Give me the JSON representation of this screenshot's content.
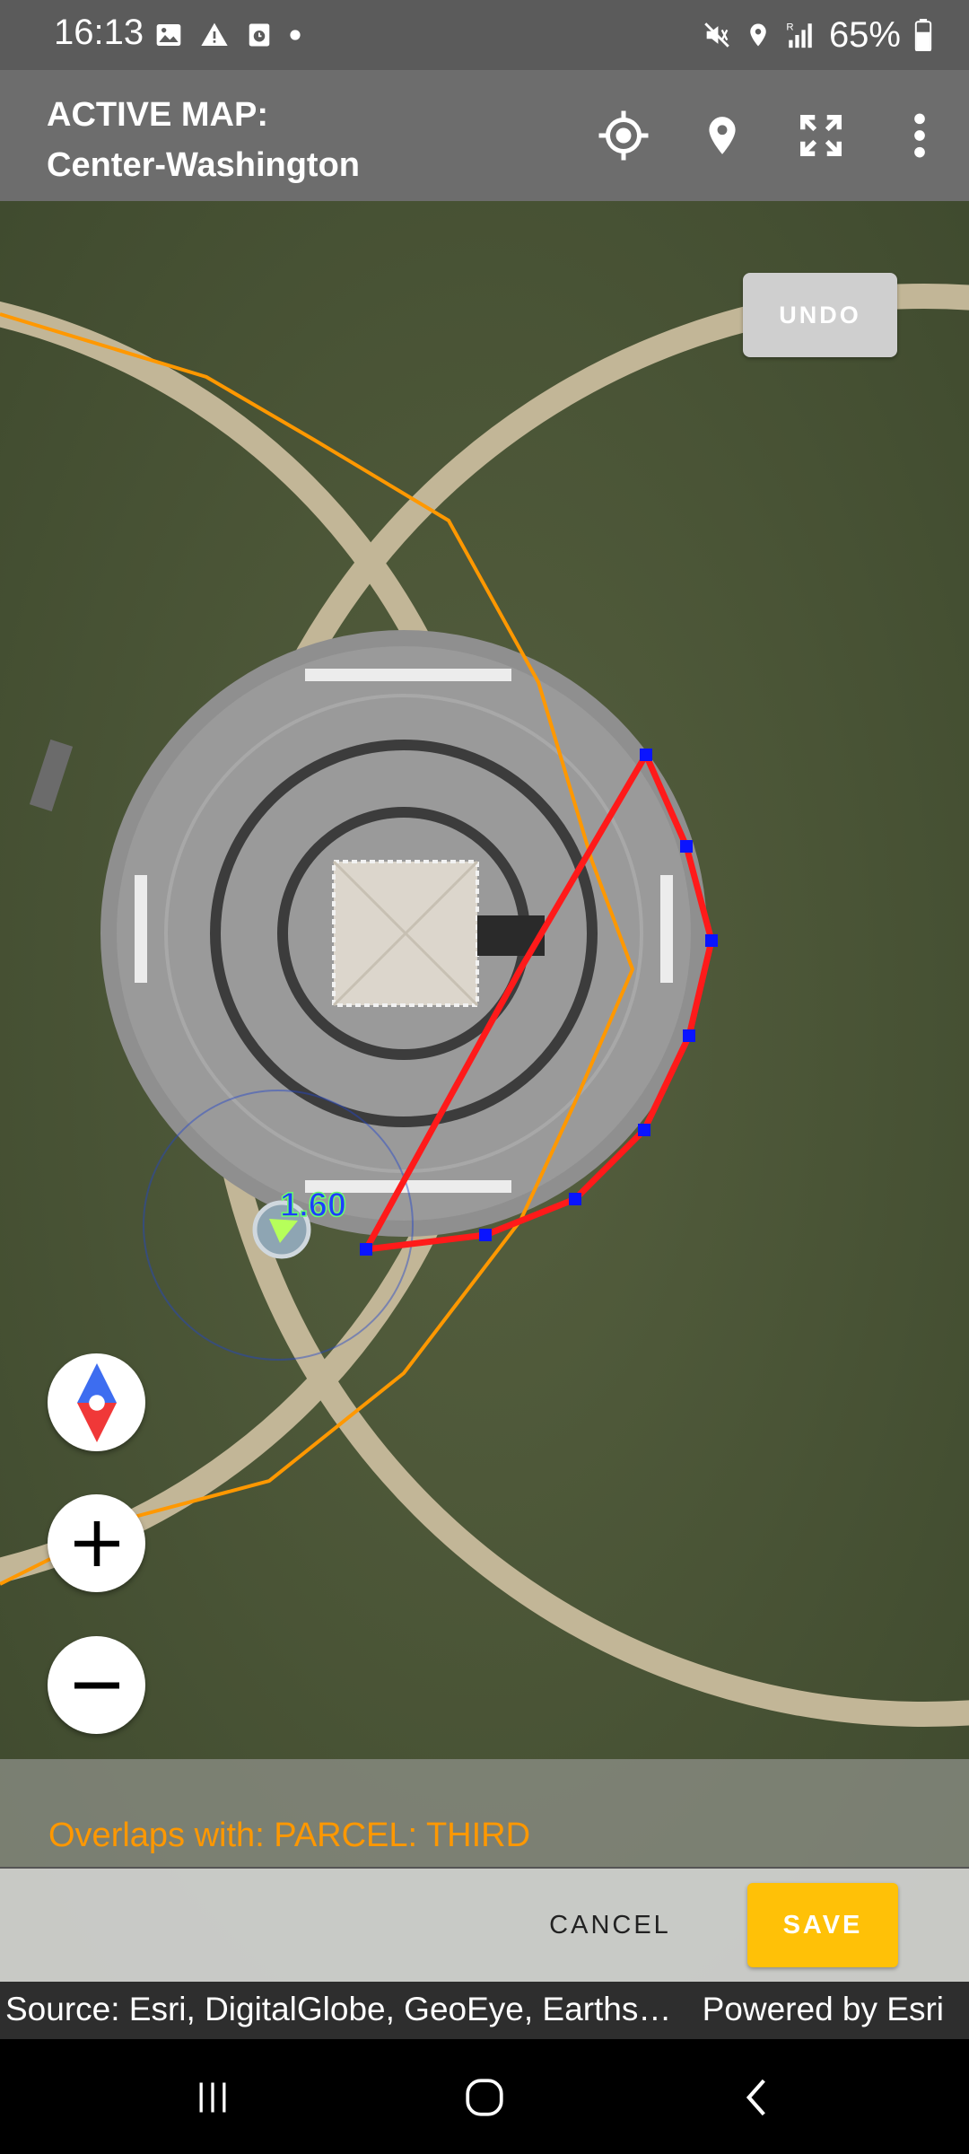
{
  "status_bar": {
    "time": "16:13",
    "battery": "65%",
    "icons": [
      "image-icon",
      "warning-icon",
      "clock-app-icon",
      "dot-icon",
      "mute-icon",
      "location-icon",
      "signal-icon",
      "battery-icon"
    ]
  },
  "app_bar": {
    "title_line1": "ACTIVE MAP:",
    "title_line2": "Center-Washington",
    "actions": [
      "my-location-icon",
      "place-pin-icon",
      "fullscreen-icon",
      "more-vert-icon"
    ]
  },
  "map": {
    "undo_label": "UNDO",
    "measurement_label": "1.60",
    "controls": [
      "compass-icon",
      "zoom-in-icon",
      "zoom-out-icon"
    ],
    "colors": {
      "drawn_polygon": "#ff1a1a",
      "vertex": "#0a14ff",
      "parcel_boundary": "#ff9800",
      "measure_text": "#1f3fff"
    }
  },
  "overlap_message": "Overlaps with: PARCEL: THIRD",
  "actions": {
    "cancel_label": "CANCEL",
    "save_label": "SAVE"
  },
  "attribution": {
    "source": "Source: Esri, DigitalGlobe, GeoEye, Earths…",
    "powered_by": "Powered by Esri"
  },
  "nav_bar": {
    "buttons": [
      "recent-apps-icon",
      "home-icon",
      "back-icon"
    ]
  }
}
